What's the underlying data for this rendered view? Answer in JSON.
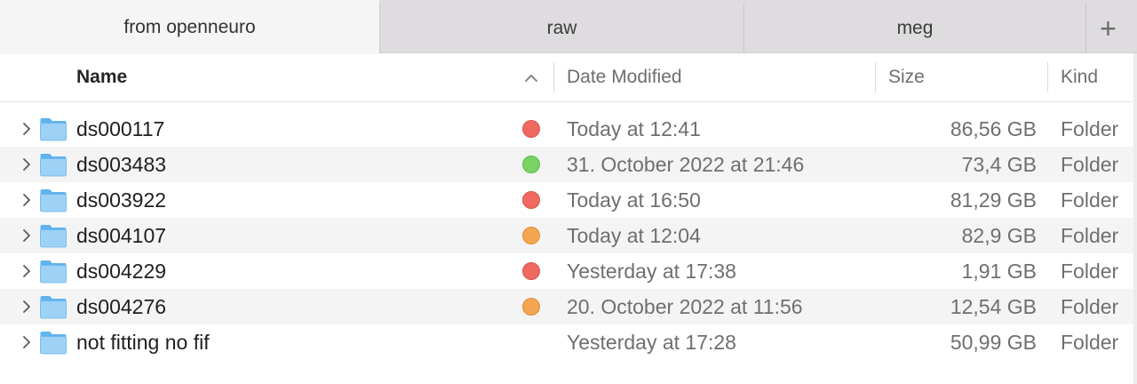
{
  "tabs": [
    {
      "label": "from openneuro",
      "active": true
    },
    {
      "label": "raw",
      "active": false
    },
    {
      "label": "meg",
      "active": false
    }
  ],
  "new_tab_label": "+",
  "columns": {
    "name": "Name",
    "date": "Date Modified",
    "size": "Size",
    "kind": "Kind",
    "sort_icon": "chevron-up-icon"
  },
  "tag_colors": {
    "red": "#ee6a5f",
    "green": "#79d263",
    "orange": "#f5a551"
  },
  "files": [
    {
      "name": "ds000117",
      "tag": "red",
      "date": "Today at 12:41",
      "size": "86,56 GB",
      "kind": "Folder"
    },
    {
      "name": "ds003483",
      "tag": "green",
      "date": "31. October 2022 at 21:46",
      "size": "73,4 GB",
      "kind": "Folder"
    },
    {
      "name": "ds003922",
      "tag": "red",
      "date": "Today at 16:50",
      "size": "81,29 GB",
      "kind": "Folder"
    },
    {
      "name": "ds004107",
      "tag": "orange",
      "date": "Today at 12:04",
      "size": "82,9 GB",
      "kind": "Folder"
    },
    {
      "name": "ds004229",
      "tag": "red",
      "date": "Yesterday at 17:38",
      "size": "1,91 GB",
      "kind": "Folder"
    },
    {
      "name": "ds004276",
      "tag": "orange",
      "date": "20. October 2022 at 11:56",
      "size": "12,54 GB",
      "kind": "Folder"
    },
    {
      "name": "not fitting no fif",
      "tag": null,
      "date": "Yesterday at 17:28",
      "size": "50,99 GB",
      "kind": "Folder"
    }
  ]
}
